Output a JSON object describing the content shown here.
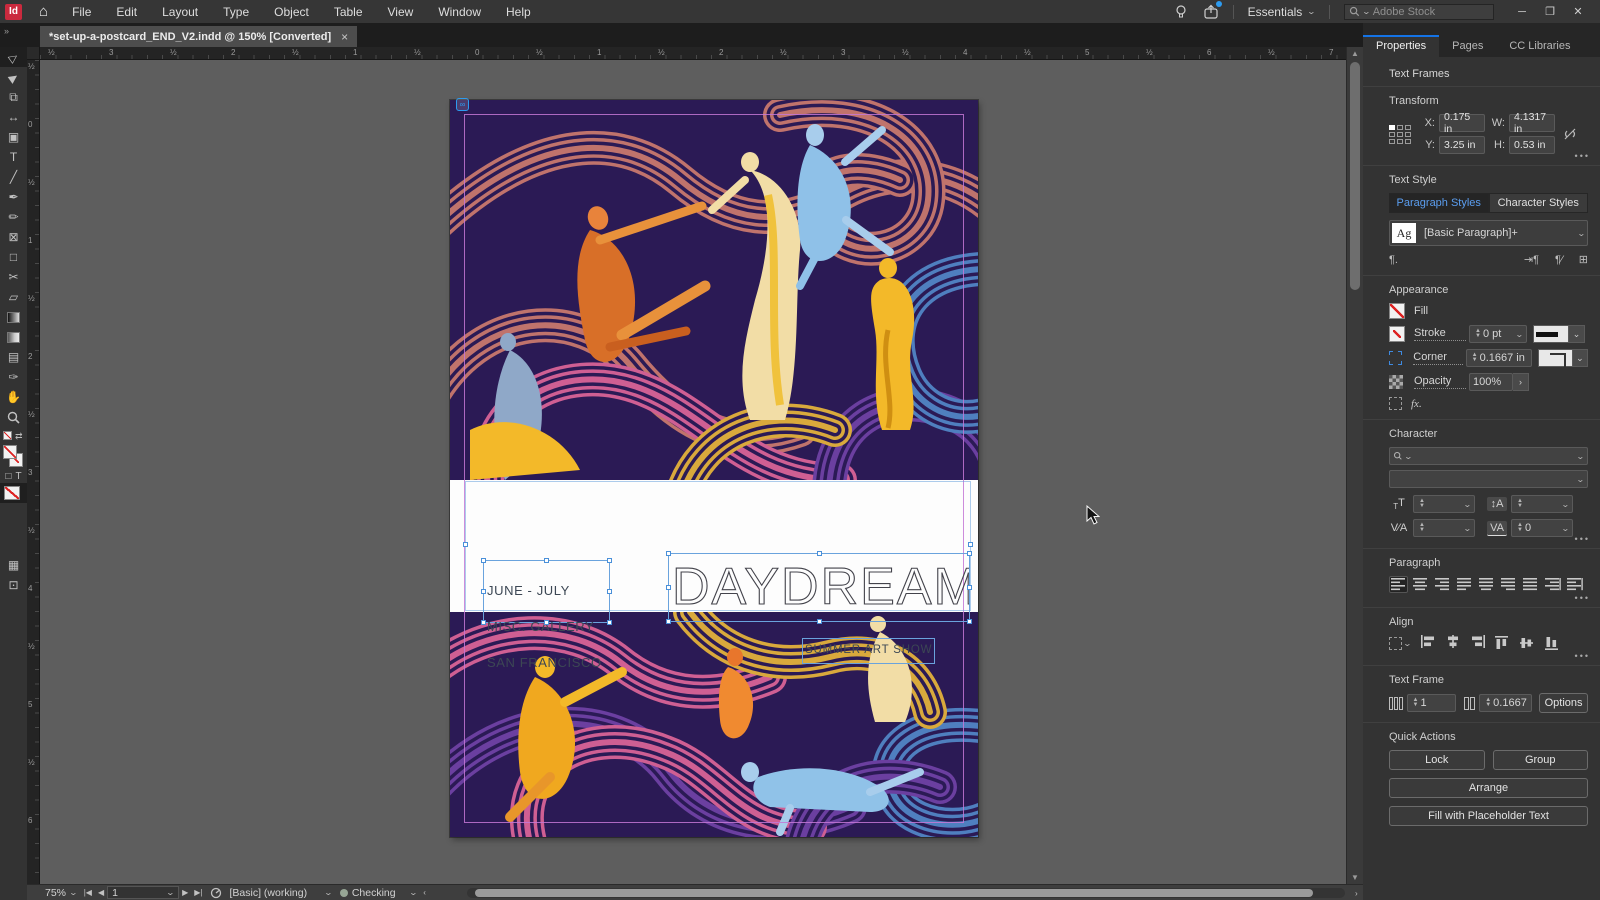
{
  "app_bar": {
    "logo": "Id",
    "menus": [
      "File",
      "Edit",
      "Layout",
      "Type",
      "Object",
      "Table",
      "View",
      "Window",
      "Help"
    ],
    "workspace": "Essentials",
    "stock_search_placeholder": "Adobe Stock"
  },
  "document_tab": {
    "title": "*set-up-a-postcard_END_V2.indd @ 150% [Converted]",
    "close": "×"
  },
  "rulers": {
    "horizontal": [
      "½",
      "3",
      "½",
      "2",
      "½",
      "1",
      "½",
      "0",
      "½",
      "1",
      "½",
      "2",
      "½",
      "3",
      "½",
      "4",
      "½",
      "5",
      "½",
      "6",
      "½",
      "7"
    ],
    "vertical": [
      "½",
      "0",
      "½",
      "1",
      "½",
      "2",
      "½",
      "3",
      "½",
      "4",
      "½",
      "5",
      "½",
      "6"
    ]
  },
  "toolbar": {
    "tools": [
      "selection-tool",
      "direct-selection-tool",
      "page-tool",
      "gap-tool",
      "content-collector-tool",
      "type-tool",
      "line-tool",
      "pen-tool",
      "pencil-tool",
      "rectangle-frame-tool",
      "rectangle-tool",
      "scissors-tool",
      "free-transform-tool",
      "gradient-swatch-tool",
      "gradient-feather-tool",
      "note-tool",
      "eyedropper-tool",
      "hand-tool",
      "zoom-tool"
    ]
  },
  "canvas": {
    "texts": {
      "dates": "JUNE - JULY",
      "gallery": "MISC. GALLERY",
      "city": "SAN FRANCISCO",
      "title": "DAYDREAM",
      "subtitle": "SUMMER ART SHOW"
    }
  },
  "panel": {
    "tabs": [
      {
        "label": "Properties"
      },
      {
        "label": "Pages"
      },
      {
        "label": "CC Libraries"
      }
    ],
    "selection_type": "Text Frames",
    "transform": {
      "label": "Transform",
      "x_label": "X:",
      "x": "0.175 in",
      "y_label": "Y:",
      "y": "3.25 in",
      "w_label": "W:",
      "w": "4.1317 in",
      "h_label": "H:",
      "h": "0.53 in"
    },
    "text_style": {
      "label": "Text Style",
      "paragraph_tab": "Paragraph Styles",
      "character_tab": "Character Styles",
      "ag": "Ag",
      "style_name": "[Basic Paragraph]+"
    },
    "appearance": {
      "label": "Appearance",
      "fill_label": "Fill",
      "stroke_label": "Stroke",
      "stroke_value": "0 pt",
      "corner_label": "Corner",
      "corner_value": "0.1667 in",
      "opacity_label": "Opacity",
      "opacity_value": "100%",
      "fx_label": "fx."
    },
    "character": {
      "label": "Character",
      "tracking_value": "0"
    },
    "paragraph": {
      "label": "Paragraph"
    },
    "align": {
      "label": "Align"
    },
    "text_frame": {
      "label": "Text Frame",
      "columns_value": "1",
      "gutter_value": "0.1667",
      "options_label": "Options"
    },
    "quick_actions": {
      "label": "Quick Actions",
      "lock": "Lock",
      "group": "Group",
      "arrange": "Arrange",
      "fill_placeholder": "Fill with Placeholder Text"
    }
  },
  "status_bar": {
    "zoom": "75%",
    "page": "1",
    "workspace_status": "[Basic] (working)",
    "preflight_status": "Checking"
  },
  "colors": {
    "accent": "#1473e6",
    "selection_blue": "#6aa3dd",
    "pasteboard": "#5e5e5e",
    "artwork_bg": "#2b1a55",
    "ribbon_salmon": "#c0736c",
    "ribbon_pink": "#cf5f93",
    "ribbon_purple": "#6b3fa0",
    "ribbon_blue": "#4f7fbf",
    "ribbon_yellow": "#d9a93c",
    "figure_orange": "#e07a2e",
    "figure_blue": "#8fc1e8",
    "figure_cream": "#f2dda6",
    "preflight_dot": "#97a695"
  }
}
